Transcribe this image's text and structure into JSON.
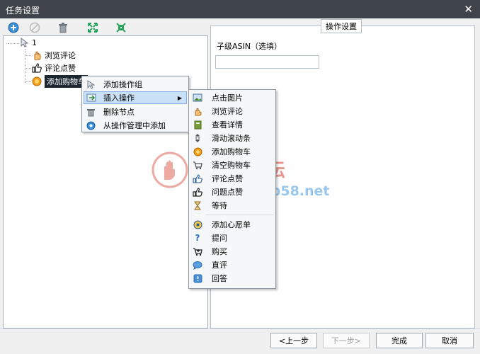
{
  "window": {
    "title": "任务设置",
    "close_symbol": "✕"
  },
  "toolbar": {
    "icons": [
      "add-icon",
      "disable-icon",
      "delete-icon",
      "expand-icon",
      "collapse-icon"
    ]
  },
  "tree": {
    "root": "1",
    "children": [
      {
        "label": "浏览评论",
        "icon": "hand-icon"
      },
      {
        "label": "评论点赞",
        "icon": "thumbs-up-icon"
      },
      {
        "label": "添加购物车",
        "icon": "cart-icon",
        "selected": true
      }
    ]
  },
  "context_menu": {
    "items": [
      {
        "label": "添加操作组"
      },
      {
        "label": "插入操作",
        "has_submenu": true,
        "highlighted": true
      },
      {
        "label": "删除节点"
      },
      {
        "label": "从操作管理中添加"
      }
    ]
  },
  "submenu": {
    "items": [
      {
        "label": "点击图片"
      },
      {
        "label": "浏览评论"
      },
      {
        "label": "查看详情"
      },
      {
        "label": "滑动滚动条"
      },
      {
        "label": "添加购物车"
      },
      {
        "label": "清空购物车"
      },
      {
        "label": "评论点赞"
      },
      {
        "label": "问题点赞"
      },
      {
        "label": "等待"
      },
      {
        "label": "添加心愿单"
      },
      {
        "label": "提问"
      },
      {
        "label": "购买"
      },
      {
        "label": "直评"
      },
      {
        "label": "回答"
      }
    ]
  },
  "settings": {
    "group_title": "操作设置",
    "field_label": "子级ASIN（选填）",
    "field_value": ""
  },
  "footer": {
    "prev_label": "<上一步",
    "next_label": "下一步>",
    "finish_label": "完成",
    "cancel_label": "取消"
  },
  "watermark": {
    "title": "TB58论坛",
    "url": "www.tb58.net"
  },
  "colors": {
    "titlebar": "#3e4449",
    "selection": "#1c2630",
    "menu_highlight": "#c9e1f7"
  }
}
